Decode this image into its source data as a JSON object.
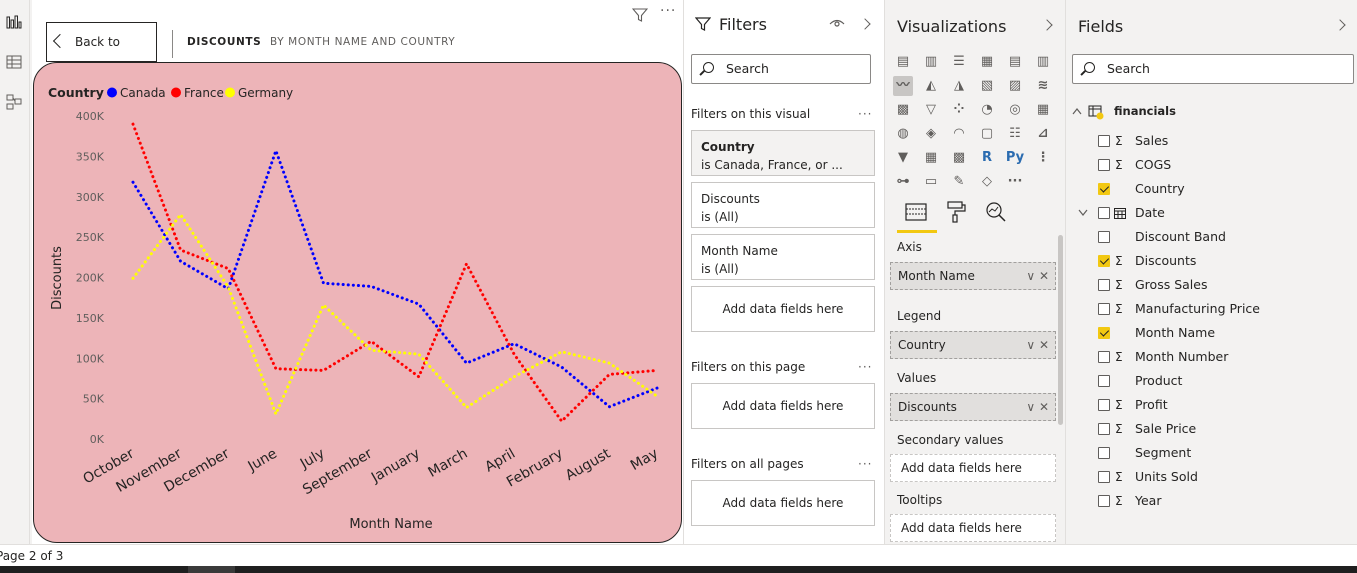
{
  "canvas": {
    "back_button": "Back to report",
    "drill_title": "DISCOUNTS",
    "drill_subtitle": "BY MONTH NAME AND COUNTRY"
  },
  "chart_data": {
    "type": "line",
    "legend_title": "Country",
    "legend_position": "top-left",
    "xlabel": "Month Name",
    "ylabel": "Discounts",
    "categories": [
      "October",
      "November",
      "December",
      "June",
      "July",
      "September",
      "January",
      "March",
      "April",
      "February",
      "August",
      "May"
    ],
    "yticks": [
      "400K",
      "350K",
      "300K",
      "250K",
      "200K",
      "150K",
      "100K",
      "50K",
      "0K"
    ],
    "ylim": [
      0,
      400000
    ],
    "grid": false,
    "series": [
      {
        "name": "Canada",
        "color": "#0000ff",
        "values": [
          318000,
          220000,
          186000,
          357000,
          193000,
          189000,
          167000,
          94000,
          118000,
          89000,
          40000,
          63000
        ]
      },
      {
        "name": "France",
        "color": "#ff0000",
        "values": [
          390000,
          234000,
          211000,
          87000,
          85000,
          121000,
          77000,
          217000,
          105000,
          22000,
          80000,
          85000
        ]
      },
      {
        "name": "Germany",
        "color": "#ffff00",
        "values": [
          199000,
          278000,
          188000,
          31000,
          166000,
          110000,
          105000,
          39000,
          77000,
          108000,
          94000,
          53000
        ]
      }
    ],
    "background": "#edb4b8"
  },
  "filters": {
    "title": "Filters",
    "search_placeholder": "Search",
    "on_visual_label": "Filters on this visual",
    "visual_filters": [
      {
        "name": "Country",
        "value": "is Canada, France, or ..."
      },
      {
        "name": "Discounts",
        "value": "is (All)"
      },
      {
        "name": "Month Name",
        "value": "is (All)"
      }
    ],
    "add_data_fields": "Add data fields here",
    "on_page_label": "Filters on this page",
    "on_all_pages_label": "Filters on all pages"
  },
  "visualizations": {
    "title": "Visualizations",
    "icon_row5_text": [
      "R",
      "Py"
    ],
    "icon_row6_text": "···",
    "wells": {
      "axis_label": "Axis",
      "axis_value": "Month Name",
      "legend_label": "Legend",
      "legend_value": "Country",
      "values_label": "Values",
      "values_value": "Discounts",
      "secondary_label": "Secondary values",
      "secondary_placeholder": "Add data fields here",
      "tooltips_label": "Tooltips",
      "tooltips_placeholder": "Add data fields here"
    },
    "well_controls": "∨ ✕"
  },
  "fields": {
    "title": "Fields",
    "search_placeholder": "Search",
    "table_name": "financials",
    "sigma": "Σ",
    "items": [
      {
        "label": "Sales",
        "checked": false,
        "sigma": true
      },
      {
        "label": "COGS",
        "checked": false,
        "sigma": true
      },
      {
        "label": "Country",
        "checked": true,
        "sigma": false
      },
      {
        "label": "Date",
        "checked": false,
        "sigma": false,
        "calendar": true,
        "expandable": true
      },
      {
        "label": "Discount Band",
        "checked": false,
        "sigma": false
      },
      {
        "label": "Discounts",
        "checked": true,
        "sigma": true
      },
      {
        "label": "Gross Sales",
        "checked": false,
        "sigma": true
      },
      {
        "label": "Manufacturing Price",
        "checked": false,
        "sigma": true
      },
      {
        "label": "Month Name",
        "checked": true,
        "sigma": false
      },
      {
        "label": "Month Number",
        "checked": false,
        "sigma": true
      },
      {
        "label": "Product",
        "checked": false,
        "sigma": false
      },
      {
        "label": "Profit",
        "checked": false,
        "sigma": true
      },
      {
        "label": "Sale Price",
        "checked": false,
        "sigma": true
      },
      {
        "label": "Segment",
        "checked": false,
        "sigma": false
      },
      {
        "label": "Units Sold",
        "checked": false,
        "sigma": true
      },
      {
        "label": "Year",
        "checked": false,
        "sigma": true
      }
    ]
  },
  "status": {
    "page_indicator": "Page 2 of 3"
  }
}
